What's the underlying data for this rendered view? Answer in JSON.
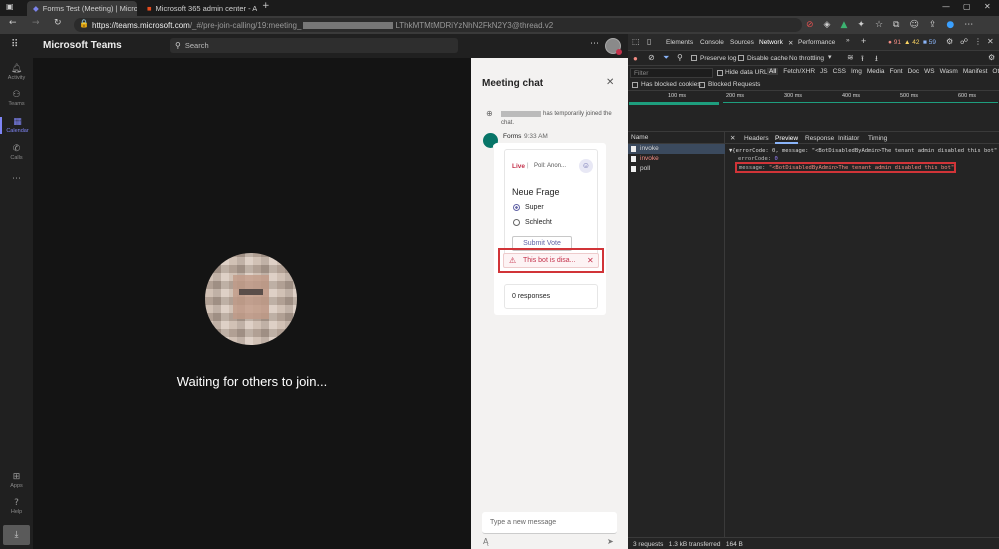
{
  "browser": {
    "tabs": [
      {
        "title": "Forms Test (Meeting) | Microsof"
      },
      {
        "title": "Microsoft 365 admin center - A"
      }
    ],
    "url_prefix": "https://teams.microsoft.com",
    "url_rest": "/_#/pre-join-calling/19:meeting_",
    "url_suffix": "LThkMTMtMDRiYzNhN2FkN2Y3@thread.v2"
  },
  "teams": {
    "app_name": "Microsoft Teams",
    "search_placeholder": "Search",
    "rail": [
      {
        "label": "Activity",
        "icon": "bell-icon"
      },
      {
        "label": "Teams",
        "icon": "teams-icon"
      },
      {
        "label": "Calendar",
        "icon": "calendar-icon"
      },
      {
        "label": "Calls",
        "icon": "phone-icon"
      },
      {
        "label": "Apps",
        "icon": "apps-icon"
      },
      {
        "label": "Help",
        "icon": "help-icon"
      }
    ],
    "waiting_text": "Waiting for others to join..."
  },
  "chat": {
    "title": "Meeting chat",
    "joined_text": "has temporarily joined the chat.",
    "sender": "Forms",
    "time": "9:33 AM",
    "live_label": "Live",
    "poll_label": "Poll: Anon...",
    "question": "Neue Frage",
    "options": [
      "Super",
      "Schlecht"
    ],
    "submit_label": "Submit Vote",
    "error_text": "This bot is disa...",
    "responses": "0 responses",
    "input_placeholder": "Type a new message"
  },
  "devtools": {
    "tabs": [
      "Elements",
      "Console",
      "Sources",
      "Network",
      "Performance"
    ],
    "active_tab": "Network",
    "errors": "91",
    "warnings": "42",
    "info": "59",
    "preserve_log": "Preserve log",
    "disable_cache": "Disable cache",
    "throttling": "No throttling",
    "filter_placeholder": "Filter",
    "hide_data_urls": "Hide data URLs",
    "filter_types": [
      "All",
      "Fetch/XHR",
      "JS",
      "CSS",
      "Img",
      "Media",
      "Font",
      "Doc",
      "WS",
      "Wasm",
      "Manifest",
      "Other"
    ],
    "blocked_cookies": "Has blocked cookies",
    "blocked_requests": "Blocked Requests",
    "timeline_ticks": [
      "100 ms",
      "200 ms",
      "300 ms",
      "400 ms",
      "500 ms",
      "600 ms"
    ],
    "name_header": "Name",
    "requests": [
      {
        "name": "invoke",
        "error": false
      },
      {
        "name": "invoke",
        "error": true
      },
      {
        "name": "poll",
        "error": false
      }
    ],
    "detail_tabs": [
      "Headers",
      "Preview",
      "Response",
      "Initiator",
      "Timing"
    ],
    "active_detail_tab": "Preview",
    "preview_line1": "▼{errorCode: 0, message: \"<BotDisabledByAdmin>The tenant admin disabled this bot\"}",
    "preview_key1": "errorCode: ",
    "preview_val1": "0",
    "preview_key2": "message: ",
    "preview_val2": "\"<BotDisabledByAdmin>The tenant admin disabled this bot\"",
    "status": "3 requests   1.3 kB transferred   164 B",
    "colors": {
      "accent": "#6264a7",
      "error": "#d13438",
      "link": "#7f85f5"
    }
  }
}
